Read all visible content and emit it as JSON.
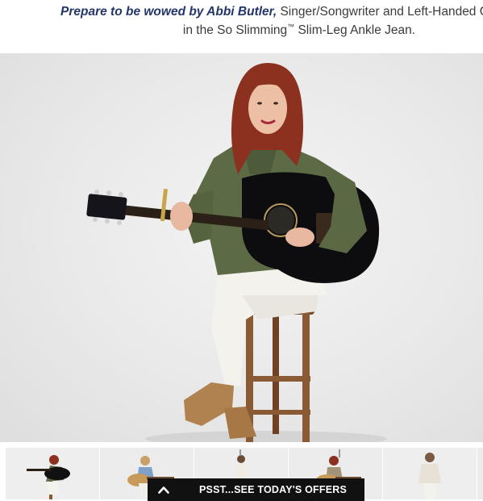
{
  "caption": {
    "line1_emphasis": "Prepare to be wowed by Abbi Butler,",
    "line1_rest": " Singer/Songwriter and Left-Handed Gu",
    "line2_main": "in the So Slimming",
    "line2_tm": "™",
    "line2_end": " Slim-Leg Ankle Jean."
  },
  "thumbnails": {
    "selected_index": 0,
    "count": 6
  },
  "offers_bar": {
    "label": "PSST...SEE TODAY'S OFFERS",
    "icon": "chevron-up-icon"
  },
  "colors": {
    "accent": "#23356b",
    "selected_outline": "#2a3d8c",
    "offers_bg": "#111111"
  }
}
